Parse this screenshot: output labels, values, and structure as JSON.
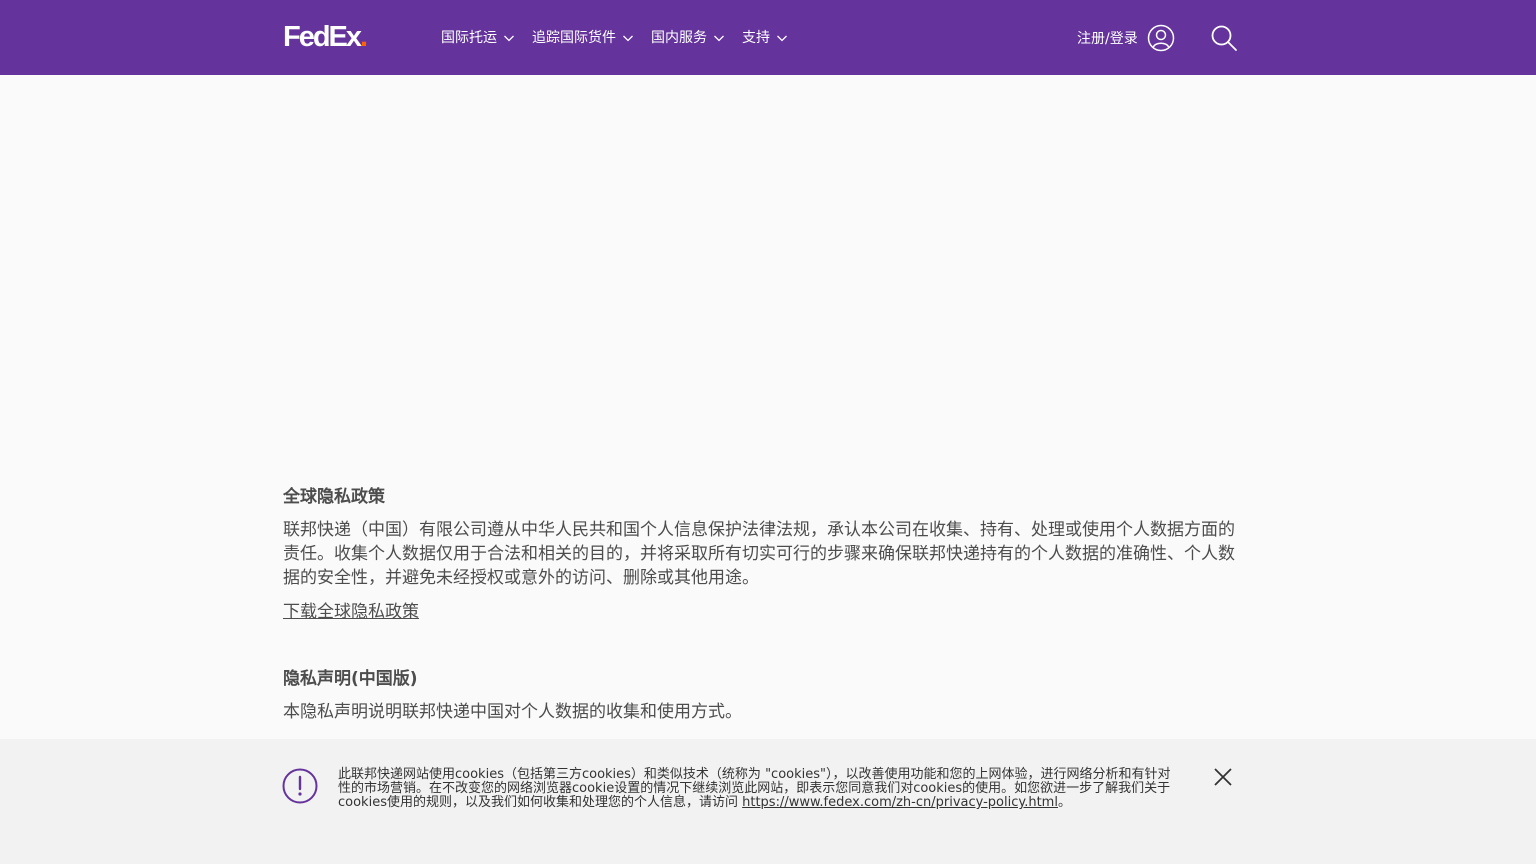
{
  "header": {
    "logo": {
      "main": "FedEx",
      "dot": "."
    },
    "nav": [
      {
        "label": "国际托运"
      },
      {
        "label": "追踪国际货件"
      },
      {
        "label": "国内服务"
      },
      {
        "label": "支持"
      }
    ],
    "login_label": "注册/登录",
    "icons": {
      "user": "user-icon",
      "search": "search-icon",
      "chevron": "chevron-down-icon"
    }
  },
  "colors": {
    "brand_purple": "#64339c",
    "brand_orange": "#ff6200",
    "background": "#fafafa",
    "banner_bg": "#f2f2f2"
  },
  "main": {
    "section1": {
      "title": "全球隐私政策",
      "body": "联邦快递（中国）有限公司遵从中华人民共和国个人信息保护法律法规，承认本公司在收集、持有、处理或使用个人数据方面的责任。收集个人数据仅用于合法和相关的目的，并将采取所有切实可行的步骤来确保联邦快递持有的个人数据的准确性、个人数据的安全性，并避免未经授权或意外的访问、删除或其他用途。",
      "link": "下载全球隐私政策"
    },
    "section2": {
      "title": "隐私声明(中国版)",
      "body": "本隐私声明说明联邦快递中国对个人数据的收集和使用方式。"
    }
  },
  "cookie_banner": {
    "text": "此联邦快递网站使用cookies（包括第三方cookies）和类似技术（统称为 \"cookies\"），以改善使用功能和您的上网体验，进行网络分析和有针对性的市场营销。在不改变您的网络浏览器cookie设置的情况下继续浏览此网站，即表示您同意我们对cookies的使用。如您欲进一步了解我们关于cookies使用的规则，以及我们如何收集和处理您的个人信息，请访问 ",
    "link": "https://www.fedex.com/zh-cn/privacy-policy.html",
    "end": "。",
    "icons": {
      "alert": "alert-icon",
      "close": "close-icon"
    }
  }
}
